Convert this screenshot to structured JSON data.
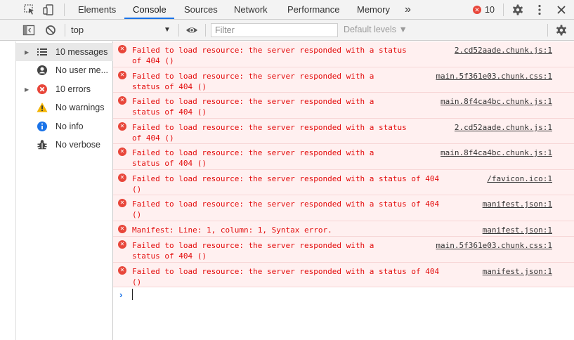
{
  "tabbar": {
    "tabs": [
      {
        "label": "Elements",
        "active": false
      },
      {
        "label": "Console",
        "active": true
      },
      {
        "label": "Sources",
        "active": false
      },
      {
        "label": "Network",
        "active": false
      },
      {
        "label": "Performance",
        "active": false
      },
      {
        "label": "Memory",
        "active": false
      }
    ],
    "more_label": "»",
    "error_count": "10",
    "accent_color": "#1a73e8"
  },
  "toolbar": {
    "context_label": "top",
    "context_caret": "▼",
    "filter_placeholder": "Filter",
    "filter_value": "",
    "levels_label": "Default levels ▼"
  },
  "sidebar": {
    "items": [
      {
        "label": "10 messages",
        "icon": "list-icon",
        "expandable": true
      },
      {
        "label": "No user me...",
        "icon": "user-icon",
        "expandable": false
      },
      {
        "label": "10 errors",
        "icon": "error-icon",
        "expandable": true
      },
      {
        "label": "No warnings",
        "icon": "warning-icon",
        "expandable": false
      },
      {
        "label": "No info",
        "icon": "info-icon",
        "expandable": false
      },
      {
        "label": "No verbose",
        "icon": "bug-icon",
        "expandable": false
      }
    ]
  },
  "messages": [
    {
      "text": "Failed to load resource: the server responded with a status\nof 404 ()",
      "source": "2.cd52aade.chunk.js:1"
    },
    {
      "text": "Failed to load resource: the server responded with a\nstatus of 404 ()",
      "source": "main.5f361e03.chunk.css:1"
    },
    {
      "text": "Failed to load resource: the server responded with a\nstatus of 404 ()",
      "source": "main.8f4ca4bc.chunk.js:1"
    },
    {
      "text": "Failed to load resource: the server responded with a status\nof 404 ()",
      "source": "2.cd52aade.chunk.js:1"
    },
    {
      "text": "Failed to load resource: the server responded with a\nstatus of 404 ()",
      "source": "main.8f4ca4bc.chunk.js:1"
    },
    {
      "text": "Failed to load resource: the server responded with a status of 404\n()",
      "source": "/favicon.ico:1"
    },
    {
      "text": "Failed to load resource: the server responded with a status of 404\n()",
      "source": "manifest.json:1"
    },
    {
      "text": "Manifest: Line: 1, column: 1, Syntax error.",
      "source": "manifest.json:1"
    },
    {
      "text": "Failed to load resource: the server responded with a\nstatus of 404 ()",
      "source": "main.5f361e03.chunk.css:1"
    },
    {
      "text": "Failed to load resource: the server responded with a status of 404\n()",
      "source": "manifest.json:1"
    }
  ],
  "prompt_symbol": "›",
  "colors": {
    "error_text": "#e30c0c",
    "error_background": "#fff0f0",
    "error_icon": "#e8463a",
    "warning_icon": "#f4b400",
    "info_icon": "#1a73e8"
  }
}
